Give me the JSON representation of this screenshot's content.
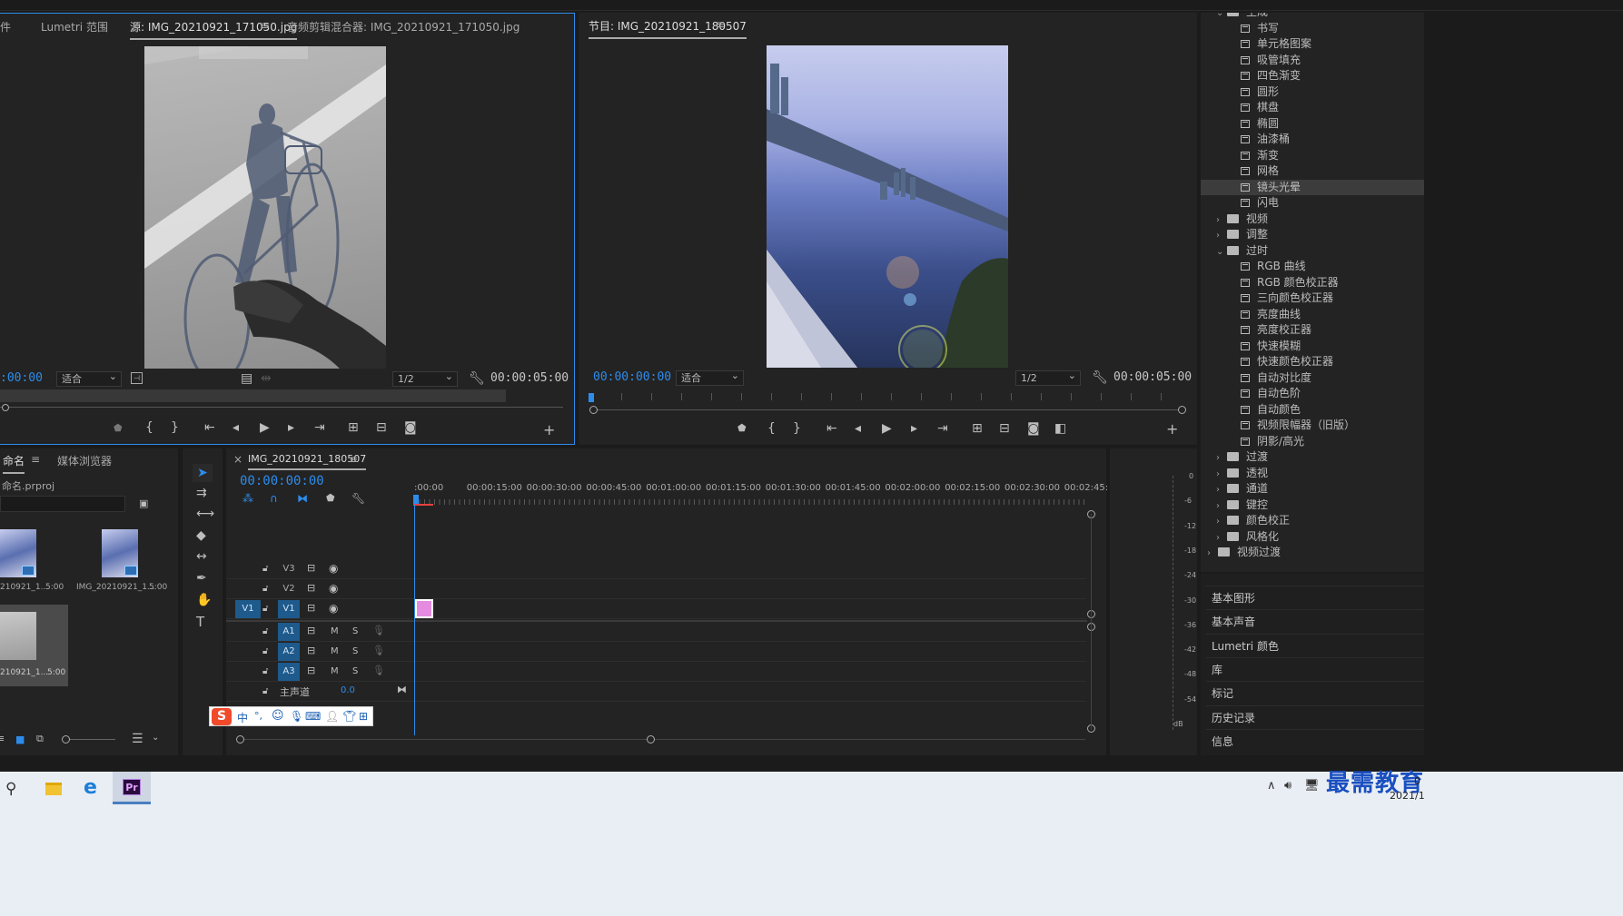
{
  "source_monitor": {
    "tabs": [
      "件",
      "Lumetri 范围",
      "源: IMG_20210921_171050.jpg",
      "音频剪辑混合器: IMG_20210921_171050.jpg"
    ],
    "menu_glyph": "≡",
    "timecode": ":00:00",
    "fit": "适合",
    "resolution": "1/2",
    "duration": "00:00:05:00"
  },
  "program_monitor": {
    "tab": "节目: IMG_20210921_180507",
    "menu_glyph": "≡",
    "timecode": "00:00:00:00",
    "fit": "适合",
    "resolution": "1/2",
    "duration": "00:00:05:00"
  },
  "effects_tree": [
    {
      "label": "生成",
      "type": "folder-open",
      "indent": 1
    },
    {
      "label": "书写",
      "type": "effect"
    },
    {
      "label": "单元格图案",
      "type": "effect"
    },
    {
      "label": "吸管填充",
      "type": "effect"
    },
    {
      "label": "四色渐变",
      "type": "effect"
    },
    {
      "label": "圆形",
      "type": "effect"
    },
    {
      "label": "棋盘",
      "type": "effect"
    },
    {
      "label": "椭圆",
      "type": "effect"
    },
    {
      "label": "油漆桶",
      "type": "effect"
    },
    {
      "label": "渐变",
      "type": "effect"
    },
    {
      "label": "网格",
      "type": "effect"
    },
    {
      "label": "镜头光晕",
      "type": "effect",
      "selected": true
    },
    {
      "label": "闪电",
      "type": "effect"
    },
    {
      "label": "视频",
      "type": "folder"
    },
    {
      "label": "调整",
      "type": "folder"
    },
    {
      "label": "过时",
      "type": "folder-open"
    },
    {
      "label": "RGB 曲线",
      "type": "effect"
    },
    {
      "label": "RGB 颜色校正器",
      "type": "effect"
    },
    {
      "label": "三向颜色校正器",
      "type": "effect"
    },
    {
      "label": "亮度曲线",
      "type": "effect"
    },
    {
      "label": "亮度校正器",
      "type": "effect"
    },
    {
      "label": "快速模糊",
      "type": "effect"
    },
    {
      "label": "快速颜色校正器",
      "type": "effect"
    },
    {
      "label": "自动对比度",
      "type": "effect"
    },
    {
      "label": "自动色阶",
      "type": "effect"
    },
    {
      "label": "自动颜色",
      "type": "effect"
    },
    {
      "label": "视频限幅器（旧版）",
      "type": "effect"
    },
    {
      "label": "阴影/高光",
      "type": "effect"
    },
    {
      "label": "过渡",
      "type": "folder"
    },
    {
      "label": "透视",
      "type": "folder"
    },
    {
      "label": "通道",
      "type": "folder"
    },
    {
      "label": "键控",
      "type": "folder"
    },
    {
      "label": "颜色校正",
      "type": "folder"
    },
    {
      "label": "风格化",
      "type": "folder"
    },
    {
      "label": "视频过渡",
      "type": "folder-root"
    }
  ],
  "right_panels": [
    "基本图形",
    "基本声音",
    "Lumetri 颜色",
    "库",
    "标记",
    "历史记录",
    "信息"
  ],
  "project": {
    "tabs": [
      "命名",
      "媒体浏览器"
    ],
    "project_file": "命名.prproj",
    "items": [
      {
        "name": "210921_1...",
        "duration": "5:00"
      },
      {
        "name": "IMG_20210921_1...",
        "duration": "5:00"
      },
      {
        "name": "210921_1...",
        "duration": "5:00"
      }
    ]
  },
  "timeline": {
    "tab": "IMG_20210921_180507",
    "close_glyph": "×",
    "timecode": "00:00:00:00",
    "ruler": [
      ":00:00",
      "00:00:15:00",
      "00:00:30:00",
      "00:00:45:00",
      "00:01:00:00",
      "00:01:15:00",
      "00:01:30:00",
      "00:01:45:00",
      "00:02:00:00",
      "00:02:15:00",
      "00:02:30:00",
      "00:02:45:"
    ],
    "video_tracks": [
      "V3",
      "V2",
      "V1"
    ],
    "audio_tracks": [
      "A1",
      "A2",
      "A3"
    ],
    "source_patch": "V1",
    "mute_label": "M",
    "solo_label": "S",
    "master": "主声道",
    "master_value": "0.0"
  },
  "meter_scale": [
    "0",
    "-6",
    "-12",
    "-18",
    "-24",
    "-30",
    "-36",
    "-42",
    "-48",
    "-54",
    "dB"
  ],
  "ime_bar": {
    "logo": "S",
    "mode": "中",
    "punct": "°,"
  },
  "taskbar": {
    "app_label": "Pr",
    "date": "2021/1",
    "time_partial": "0",
    "watermark": "最需教育"
  },
  "colors": {
    "accent": "#2d8ceb",
    "panel": "#232323",
    "clip": "#e58be0",
    "selected_track": "#1e5a8c"
  }
}
